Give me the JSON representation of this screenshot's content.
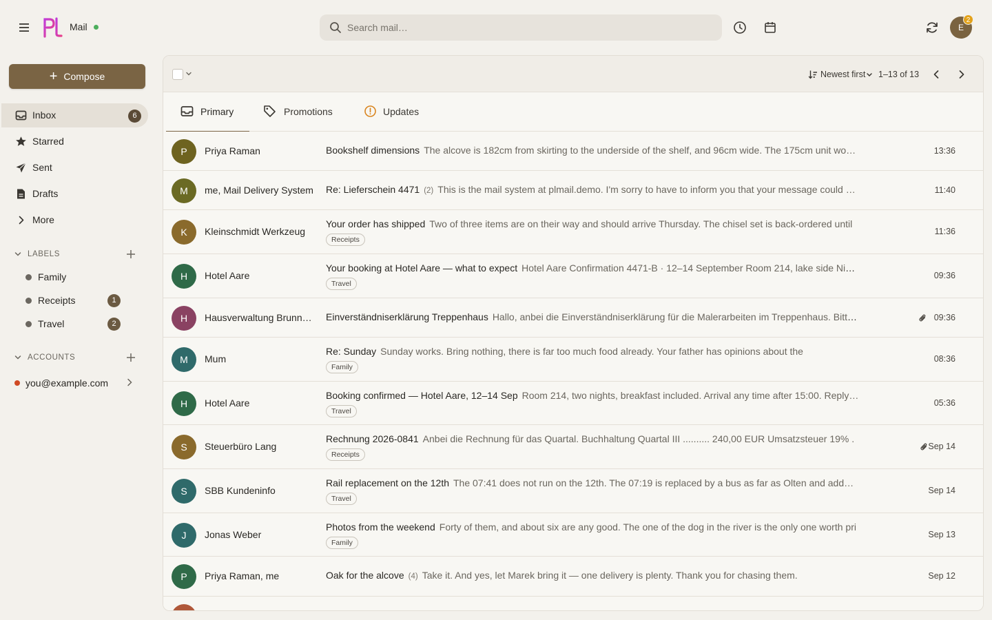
{
  "app": {
    "name": "Mail"
  },
  "search": {
    "placeholder": "Search mail…"
  },
  "user": {
    "initial": "E",
    "notifications": "2"
  },
  "compose": {
    "label": "Compose"
  },
  "nav": [
    {
      "label": "Inbox",
      "count": "6",
      "icon": "inbox-icon"
    },
    {
      "label": "Starred",
      "icon": "star-icon"
    },
    {
      "label": "Sent",
      "icon": "send-icon"
    },
    {
      "label": "Drafts",
      "icon": "draft-icon"
    },
    {
      "label": "More",
      "icon": "chevron-right-icon"
    }
  ],
  "labels": {
    "title": "LABELS",
    "items": [
      {
        "name": "Family"
      },
      {
        "name": "Receipts",
        "count": "1"
      },
      {
        "name": "Travel",
        "count": "2"
      }
    ]
  },
  "accounts": {
    "title": "ACCOUNTS",
    "items": [
      {
        "email": "you@example.com",
        "color": "#d04a24"
      }
    ]
  },
  "toolbar": {
    "sort": "Newest first",
    "range": "1–13 of 13"
  },
  "tabs": [
    {
      "label": "Primary",
      "icon": "inbox-icon"
    },
    {
      "label": "Promotions",
      "icon": "tag-icon"
    },
    {
      "label": "Updates",
      "icon": "info-circle-icon"
    }
  ],
  "emails": [
    {
      "initial": "P",
      "color": "#6e6320",
      "sender": "Priya Raman",
      "subject": "Bookshelf dimensions",
      "thread": "",
      "snippet": "The alcove is 182cm from skirting to the underside of the shelf, and 96cm wide. The 175cm unit wo…",
      "tag": "",
      "attach": false,
      "time": "13:36"
    },
    {
      "initial": "M",
      "color": "#6b6a24",
      "sender": "me, Mail Delivery System",
      "subject": "Re: Lieferschein 4471",
      "thread": "(2)",
      "snippet": "This is the mail system at plmail.demo. I'm sorry to have to inform you that your message could …",
      "tag": "",
      "attach": false,
      "time": "11:40"
    },
    {
      "initial": "K",
      "color": "#8a6a2c",
      "sender": "Kleinschmidt Werkzeug",
      "subject": "Your order has shipped",
      "thread": "",
      "snippet": "Two of three items are on their way and should arrive Thursday. The chisel set is back-ordered until",
      "tag": "Receipts",
      "attach": false,
      "time": "11:36"
    },
    {
      "initial": "H",
      "color": "#2f6a48",
      "sender": "Hotel Aare",
      "subject": "Your booking at Hotel Aare — what to expect",
      "thread": "",
      "snippet": "Hotel Aare Confirmation 4471-B · 12–14 September Room 214, lake side Nig…",
      "tag": "Travel",
      "attach": false,
      "time": "09:36"
    },
    {
      "initial": "H",
      "color": "#8a4262",
      "sender": "Hausverwaltung Brunne…",
      "subject": "Einverständniserklärung Treppenhaus",
      "thread": "",
      "snippet": "Hallo, anbei die Einverständniserklärung für die Malerarbeiten im Treppenhaus. Bitte …",
      "tag": "",
      "attach": true,
      "time": "09:36"
    },
    {
      "initial": "M",
      "color": "#2f6a6a",
      "sender": "Mum",
      "subject": "Re: Sunday",
      "thread": "",
      "snippet": "Sunday works. Bring nothing, there is far too much food already. Your father has opinions about the",
      "tag": "Family",
      "attach": false,
      "time": "08:36"
    },
    {
      "initial": "H",
      "color": "#2f6a48",
      "sender": "Hotel Aare",
      "subject": "Booking confirmed — Hotel Aare, 12–14 Sep",
      "thread": "",
      "snippet": "Room 214, two nights, breakfast included. Arrival any time after 15:00. Reply…",
      "tag": "Travel",
      "attach": false,
      "time": "05:36"
    },
    {
      "initial": "S",
      "color": "#8a6a2c",
      "sender": "Steuerbüro Lang",
      "subject": "Rechnung 2026-0841",
      "thread": "",
      "snippet": "Anbei die Rechnung für das Quartal. Buchhaltung Quartal III .......... 240,00 EUR Umsatzsteuer 19% .",
      "tag": "Receipts",
      "attach": true,
      "time": "Sep 14"
    },
    {
      "initial": "S",
      "color": "#2f6a6a",
      "sender": "SBB Kundeninfo",
      "subject": "Rail replacement on the 12th",
      "thread": "",
      "snippet": "The 07:41 does not run on the 12th. The 07:19 is replaced by a bus as far as Olten and add…",
      "tag": "Travel",
      "attach": false,
      "time": "Sep 14"
    },
    {
      "initial": "J",
      "color": "#2f6a6a",
      "sender": "Jonas Weber",
      "subject": "Photos from the weekend",
      "thread": "",
      "snippet": "Forty of them, and about six are any good. The one of the dog in the river is the only one worth pri",
      "tag": "Family",
      "attach": false,
      "time": "Sep 13"
    },
    {
      "initial": "P",
      "color": "#2f6a48",
      "sender": "Priya Raman, me",
      "subject": "Oak for the alcove",
      "thread": "(4)",
      "snippet": "Take it. And yes, let Marek bring it — one delivery is plenty. Thank you for chasing them.",
      "tag": "",
      "attach": false,
      "time": "Sep 12"
    },
    {
      "initial": "",
      "color": "#b0583a",
      "sender": "",
      "subject": "",
      "thread": "",
      "snippet": "",
      "tag": "",
      "attach": false,
      "time": ""
    }
  ]
}
